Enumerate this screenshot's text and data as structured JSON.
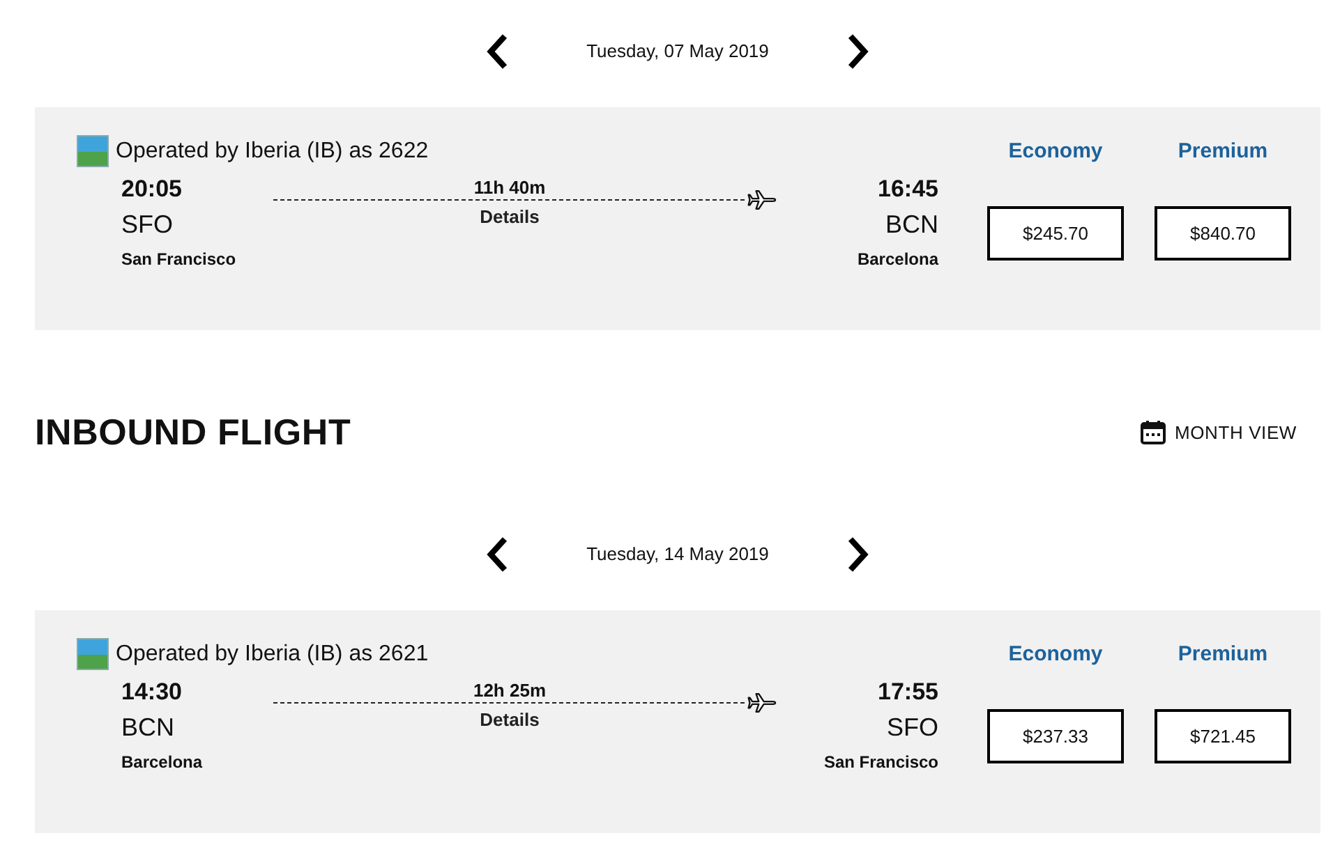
{
  "sections": [
    {
      "date_nav": {
        "date": "Tuesday, 07 May 2019"
      },
      "flight": {
        "operator": "Operated by Iberia (IB) as 2622",
        "departure": {
          "time": "20:05",
          "code": "SFO",
          "city": "San Francisco"
        },
        "duration": "11h 40m",
        "details": "Details",
        "arrival": {
          "time": "16:45",
          "code": "BCN",
          "city": "Barcelona"
        },
        "fares": [
          {
            "cabin": "Economy",
            "price": "$245.70"
          },
          {
            "cabin": "Premium",
            "price": "$840.70"
          }
        ]
      }
    },
    {
      "title": "INBOUND FLIGHT",
      "month_view": "MONTH VIEW",
      "date_nav": {
        "date": "Tuesday, 14 May 2019"
      },
      "flight": {
        "operator": "Operated by Iberia (IB) as 2621",
        "departure": {
          "time": "14:30",
          "code": "BCN",
          "city": "Barcelona"
        },
        "duration": "12h 25m",
        "details": "Details",
        "arrival": {
          "time": "17:55",
          "code": "SFO",
          "city": "San Francisco"
        },
        "fares": [
          {
            "cabin": "Economy",
            "price": "$237.33"
          },
          {
            "cabin": "Premium",
            "price": "$721.45"
          }
        ]
      }
    }
  ]
}
